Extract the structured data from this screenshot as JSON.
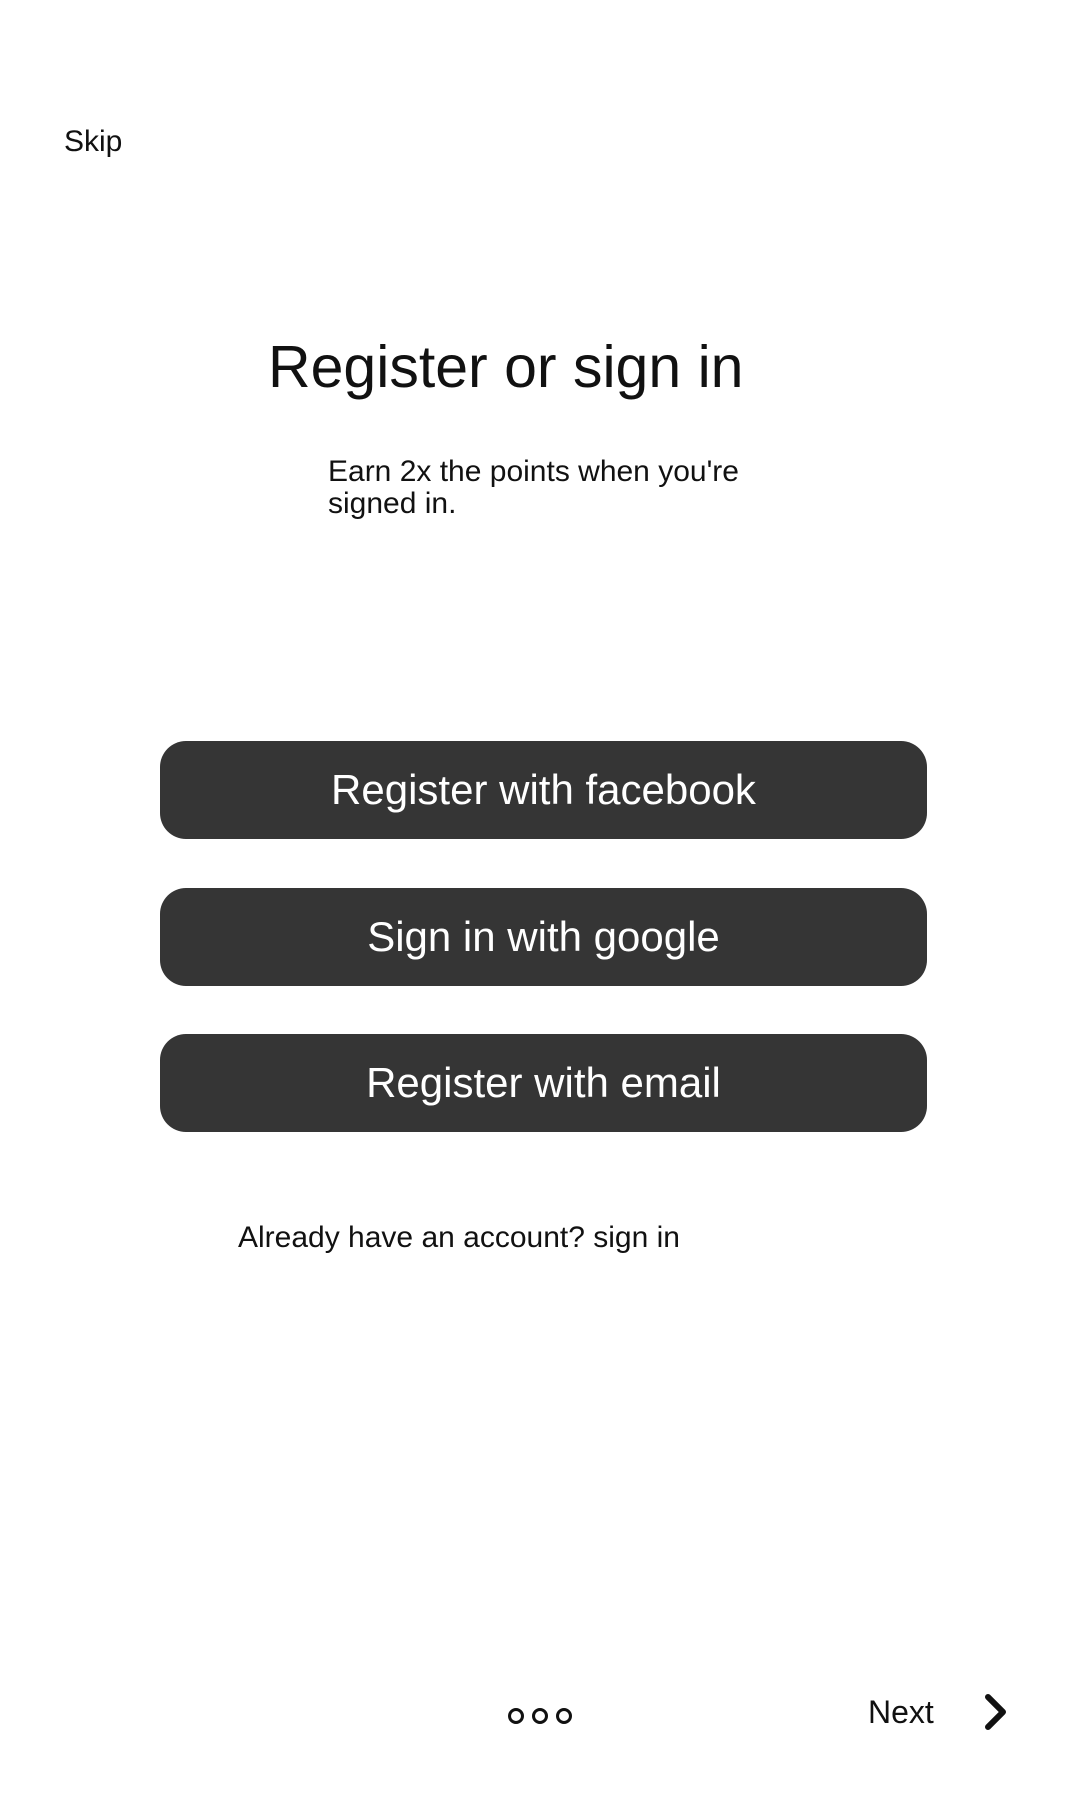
{
  "header": {
    "skip_label": "Skip"
  },
  "main": {
    "title": "Register or sign in",
    "subtitle": "Earn 2x the points when you're signed in."
  },
  "buttons": {
    "facebook_label": "Register with facebook",
    "google_label": "Sign in with google",
    "email_label": "Register with email"
  },
  "footer_text": {
    "prefix": "Already have an account? ",
    "link": "sign in"
  },
  "pager": {
    "dot_count": 3,
    "next_label": "Next",
    "next_icon": "chevron-right-icon"
  },
  "colors": {
    "button_bg": "#353535",
    "button_text": "#ffffff",
    "text": "#111111",
    "background": "#ffffff"
  }
}
